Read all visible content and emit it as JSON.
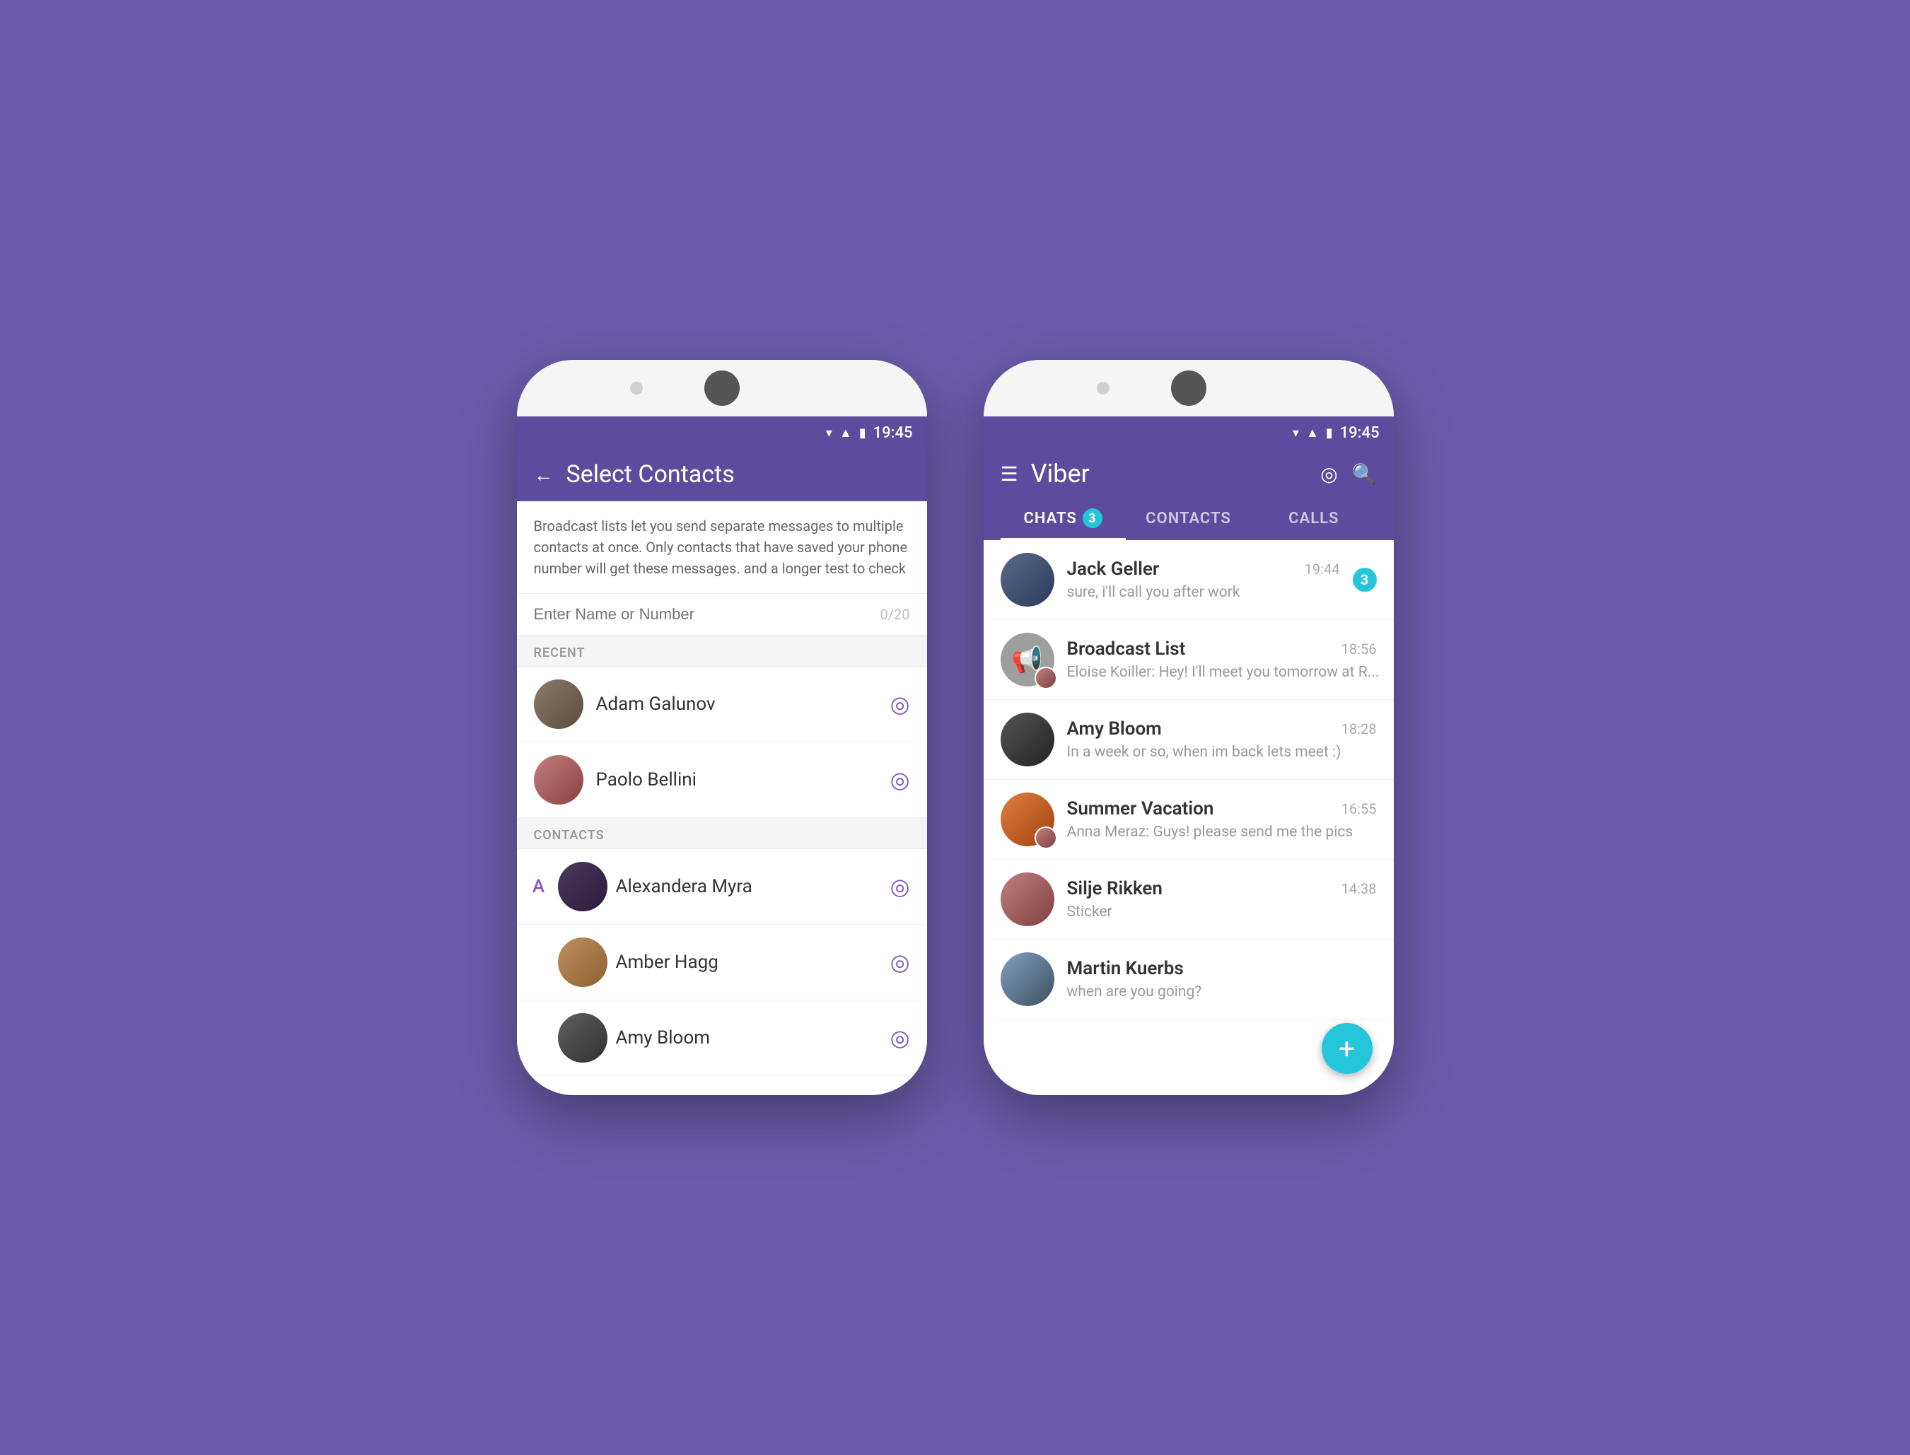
{
  "phone1": {
    "statusBar": {
      "time": "19:45",
      "icons": [
        "wifi",
        "signal",
        "battery"
      ]
    },
    "header": {
      "backLabel": "←",
      "title": "Select Contacts"
    },
    "broadcastInfo": "Broadcast lists let you send separate messages to multiple contacts at once. Only contacts that have saved your phone number will get these messages. and a longer test to check",
    "searchInput": {
      "placeholder": "Enter Name or Number",
      "count": "0/20"
    },
    "recentLabel": "RECENT",
    "recentContacts": [
      {
        "name": "Adam Galunov"
      },
      {
        "name": "Paolo Bellini"
      }
    ],
    "contactsLabel": "CONTACTS",
    "indexedContacts": [
      {
        "letter": "A",
        "name": "Alexandera Myra"
      },
      {
        "letter": "",
        "name": "Amber Hagg"
      },
      {
        "letter": "",
        "name": "Amy Bloom"
      }
    ]
  },
  "phone2": {
    "statusBar": {
      "time": "19:45"
    },
    "header": {
      "menuIcon": "☰",
      "title": "Viber",
      "icons": [
        "camera-icon",
        "search-icon"
      ]
    },
    "tabs": [
      {
        "label": "CHATS",
        "badge": "3",
        "active": true
      },
      {
        "label": "CONTACTS",
        "badge": "",
        "active": false
      },
      {
        "label": "CALLS",
        "badge": "",
        "active": false
      }
    ],
    "chats": [
      {
        "name": "Jack Geller",
        "message": "sure, i'll call you after work",
        "time": "19:44",
        "unread": "3"
      },
      {
        "name": "Broadcast List",
        "message": "Eloise Koiller: Hey! I'll meet you tomorrow at R...",
        "time": "18:56",
        "unread": ""
      },
      {
        "name": "Amy Bloom",
        "message": "In a week or so, when im back lets meet :)",
        "time": "18:28",
        "unread": ""
      },
      {
        "name": "Summer Vacation",
        "message": "Anna Meraz: Guys! please send me the pics",
        "time": "16:55",
        "unread": ""
      },
      {
        "name": "Silje Rikken",
        "message": "Sticker",
        "time": "14:38",
        "unread": ""
      },
      {
        "name": "Martin Kuerbs",
        "message": "when are you going?",
        "time": "",
        "unread": ""
      }
    ],
    "fab": "+"
  }
}
